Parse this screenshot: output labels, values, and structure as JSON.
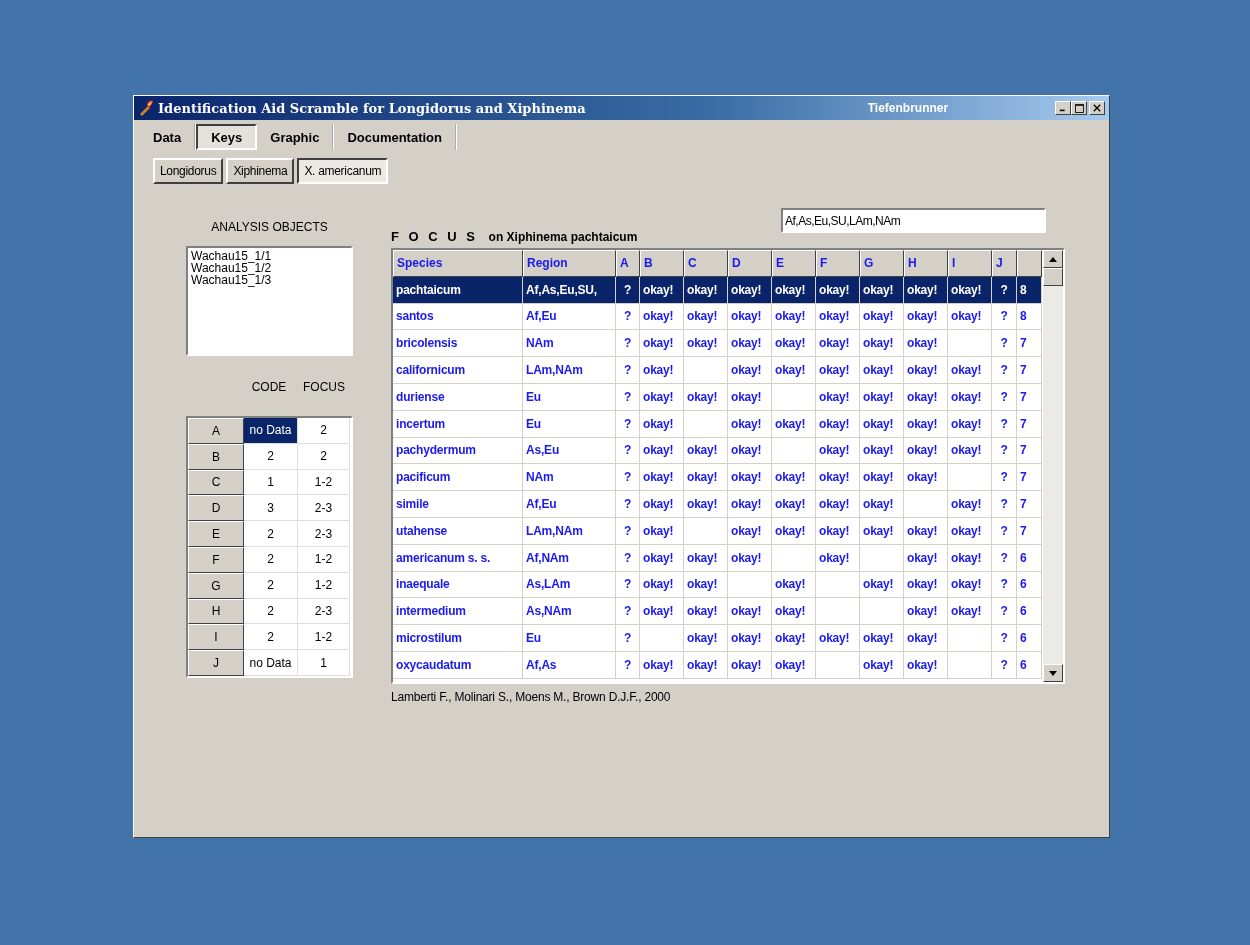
{
  "window": {
    "title": "Identification Aid Scramble for Longidorus and Xiphinema",
    "author": "Tiefenbrunner"
  },
  "tabs": [
    {
      "label": "Data",
      "selected": false
    },
    {
      "label": "Keys",
      "selected": true
    },
    {
      "label": "Graphic",
      "selected": false
    },
    {
      "label": "Documentation",
      "selected": false
    }
  ],
  "subtabs": [
    {
      "label": "Longidorus",
      "selected": false
    },
    {
      "label": "Xiphinema",
      "selected": false
    },
    {
      "label": "X. americanum",
      "selected": true
    }
  ],
  "analysis": {
    "title": "ANALYSIS OBJECTS",
    "items": [
      "Wachau15_1/1",
      "Wachau15_1/2",
      "Wachau15_1/3"
    ]
  },
  "code_table": {
    "columns": [
      "CODE",
      "FOCUS"
    ],
    "rows": [
      {
        "key": "A",
        "code": "no Data",
        "focus": "2",
        "selected": true
      },
      {
        "key": "B",
        "code": "2",
        "focus": "2",
        "selected": false
      },
      {
        "key": "C",
        "code": "1",
        "focus": "1-2",
        "selected": false
      },
      {
        "key": "D",
        "code": "3",
        "focus": "2-3",
        "selected": false
      },
      {
        "key": "E",
        "code": "2",
        "focus": "2-3",
        "selected": false
      },
      {
        "key": "F",
        "code": "2",
        "focus": "1-2",
        "selected": false
      },
      {
        "key": "G",
        "code": "2",
        "focus": "1-2",
        "selected": false
      },
      {
        "key": "H",
        "code": "2",
        "focus": "2-3",
        "selected": false
      },
      {
        "key": "I",
        "code": "2",
        "focus": "1-2",
        "selected": false
      },
      {
        "key": "J",
        "code": "no Data",
        "focus": "1",
        "selected": false
      }
    ]
  },
  "focus": {
    "label": "F O C U S",
    "text": "on Xiphinema pachtaicum"
  },
  "region_field": {
    "value": "Af,As,Eu,SU,LAm,NAm"
  },
  "table": {
    "columns": [
      "Species",
      "Region",
      "A",
      "B",
      "C",
      "D",
      "E",
      "F",
      "G",
      "H",
      "I",
      "J"
    ],
    "rows": [
      {
        "selected": true,
        "cells": [
          "pachtaicum",
          "Af,As,Eu,SU,",
          "?",
          "okay!",
          "okay!",
          "okay!",
          "okay!",
          "okay!",
          "okay!",
          "okay!",
          "okay!",
          "?",
          "8"
        ]
      },
      {
        "selected": false,
        "cells": [
          "santos",
          "Af,Eu",
          "?",
          "okay!",
          "okay!",
          "okay!",
          "okay!",
          "okay!",
          "okay!",
          "okay!",
          "okay!",
          "?",
          "8"
        ]
      },
      {
        "selected": false,
        "cells": [
          "bricolensis",
          "NAm",
          "?",
          "okay!",
          "okay!",
          "okay!",
          "okay!",
          "okay!",
          "okay!",
          "okay!",
          null,
          "?",
          "7"
        ]
      },
      {
        "selected": false,
        "cells": [
          "californicum",
          "LAm,NAm",
          "?",
          "okay!",
          null,
          "okay!",
          "okay!",
          "okay!",
          "okay!",
          "okay!",
          "okay!",
          "?",
          "7"
        ]
      },
      {
        "selected": false,
        "cells": [
          "duriense",
          "Eu",
          "?",
          "okay!",
          "okay!",
          "okay!",
          null,
          "okay!",
          "okay!",
          "okay!",
          "okay!",
          "?",
          "7"
        ]
      },
      {
        "selected": false,
        "cells": [
          "incertum",
          "Eu",
          "?",
          "okay!",
          null,
          "okay!",
          "okay!",
          "okay!",
          "okay!",
          "okay!",
          "okay!",
          "?",
          "7"
        ]
      },
      {
        "selected": false,
        "cells": [
          "pachydermum",
          "As,Eu",
          "?",
          "okay!",
          "okay!",
          "okay!",
          null,
          "okay!",
          "okay!",
          "okay!",
          "okay!",
          "?",
          "7"
        ]
      },
      {
        "selected": false,
        "cells": [
          "pacificum",
          "NAm",
          "?",
          "okay!",
          "okay!",
          "okay!",
          "okay!",
          "okay!",
          "okay!",
          "okay!",
          null,
          "?",
          "7"
        ]
      },
      {
        "selected": false,
        "cells": [
          "simile",
          "Af,Eu",
          "?",
          "okay!",
          "okay!",
          "okay!",
          "okay!",
          "okay!",
          "okay!",
          null,
          "okay!",
          "?",
          "7"
        ]
      },
      {
        "selected": false,
        "cells": [
          "utahense",
          "LAm,NAm",
          "?",
          "okay!",
          null,
          "okay!",
          "okay!",
          "okay!",
          "okay!",
          "okay!",
          "okay!",
          "?",
          "7"
        ]
      },
      {
        "selected": false,
        "cells": [
          "americanum s. s.",
          "Af,NAm",
          "?",
          "okay!",
          "okay!",
          "okay!",
          null,
          "okay!",
          null,
          "okay!",
          "okay!",
          "?",
          "6"
        ]
      },
      {
        "selected": false,
        "cells": [
          "inaequale",
          "As,LAm",
          "?",
          "okay!",
          "okay!",
          null,
          "okay!",
          null,
          "okay!",
          "okay!",
          "okay!",
          "?",
          "6"
        ]
      },
      {
        "selected": false,
        "cells": [
          "intermedium",
          "As,NAm",
          "?",
          "okay!",
          "okay!",
          "okay!",
          "okay!",
          null,
          null,
          "okay!",
          "okay!",
          "?",
          "6"
        ]
      },
      {
        "selected": false,
        "cells": [
          "microstilum",
          "Eu",
          "?",
          null,
          "okay!",
          "okay!",
          "okay!",
          "okay!",
          "okay!",
          "okay!",
          null,
          "?",
          "6"
        ]
      },
      {
        "selected": false,
        "cells": [
          "oxycaudatum",
          "Af,As",
          "?",
          "okay!",
          "okay!",
          "okay!",
          "okay!",
          null,
          "okay!",
          "okay!",
          null,
          "?",
          "6"
        ]
      }
    ]
  },
  "citation": "Lamberti F., Molinari S., Moens M., Brown D.J.F., 2000"
}
